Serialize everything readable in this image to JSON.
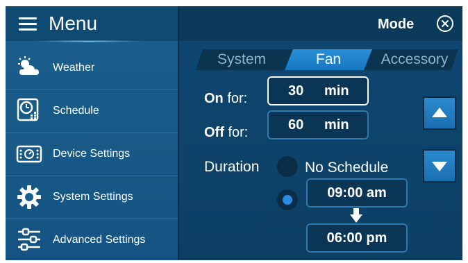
{
  "menu": {
    "title": "Menu"
  },
  "sidebar": {
    "items": [
      {
        "label": "Weather",
        "icon": "weather-icon"
      },
      {
        "label": "Schedule",
        "icon": "schedule-icon"
      },
      {
        "label": "Device Settings",
        "icon": "device-settings-icon"
      },
      {
        "label": "System Settings",
        "icon": "gear-icon"
      },
      {
        "label": "Advanced Settings",
        "icon": "sliders-icon"
      }
    ]
  },
  "header": {
    "mode_label": "Mode",
    "close_icon": "close-circle-icon"
  },
  "tabs": [
    {
      "label": "System",
      "active": false
    },
    {
      "label": "Fan",
      "active": true
    },
    {
      "label": "Accessory",
      "active": false
    }
  ],
  "fan": {
    "on": {
      "label_bold": "On",
      "label_rest": " for:",
      "value": "30",
      "unit": "min"
    },
    "off": {
      "label_bold": "Off",
      "label_rest": " for:",
      "value": "60",
      "unit": "min"
    },
    "duration_label": "Duration",
    "no_schedule_label": "No Schedule",
    "start_time": "09:00 am",
    "end_time": "06:00 pm"
  },
  "colors": {
    "accent": "#1577bf",
    "background": "#0d3e60",
    "sidebar": "#1b5f8c"
  }
}
